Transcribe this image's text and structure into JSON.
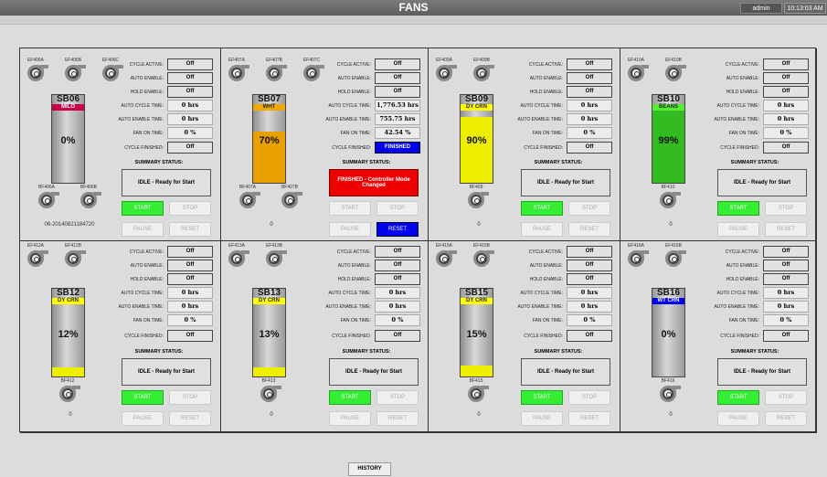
{
  "header": {
    "title": "FANS",
    "user": "admin",
    "time": "10:13:03 AM"
  },
  "labels": {
    "cycle_active": "CYCLE ACTIVE:",
    "auto_enable": "AUTO ENABLE:",
    "hold_enable": "HOLD ENABLE:",
    "auto_cycle_time": "AUTO CYCLE TIME:",
    "auto_enable_time": "AUTO ENABLE TIME:",
    "fan_on_time": "FAN ON TIME:",
    "cycle_finished": "CYCLE FINISHED:",
    "summary_status": "SUMMARY STATUS:",
    "start": "START",
    "stop": "STOP",
    "pause": "PAUSE",
    "reset": "RESET"
  },
  "colors": {
    "milo": "#c8004a",
    "wht": "#f0a800",
    "dycrn": "#ffff00",
    "beans": "#33cc22",
    "wtcrn": "#0000ee",
    "start_green": "#33ee33",
    "reset_blue": "#0000ee",
    "finished_red": "#ee0000"
  },
  "panels": [
    {
      "name": "SB06",
      "crop": "MILO",
      "crop_color": "#c8004a",
      "crop_text": "#ffffff",
      "level": 0,
      "fill_color": "#c8c8c8",
      "fans_top": [
        "EF406A",
        "EF406B",
        "EF406C"
      ],
      "fans_bottom": [
        "BF406A",
        "BF406B"
      ],
      "cycle_active": "Off",
      "auto_enable": "Off",
      "hold_enable": "Off",
      "auto_cycle_time": "0 hrs",
      "auto_enable_time": "0 hrs",
      "fan_on_time": "0 %",
      "cycle_finished": "Off",
      "summary": "IDLE - Ready for Start",
      "summary_state": "idle",
      "counter": "06-20140821184720",
      "buttons": {
        "start": "enabled",
        "stop": "disabled",
        "pause": "disabled",
        "reset": "disabled"
      }
    },
    {
      "name": "SB07",
      "crop": "WHT",
      "crop_color": "#f0a800",
      "crop_text": "#222222",
      "level": 70,
      "fill_color": "#e8a000",
      "fans_top": [
        "EF407A",
        "EF407B",
        "EF407C"
      ],
      "fans_bottom": [
        "BF407A",
        "BF407B"
      ],
      "cycle_active": "Off",
      "auto_enable": "Off",
      "hold_enable": "Off",
      "auto_cycle_time": "1,776.53 hrs",
      "auto_enable_time": "755.75 hrs",
      "fan_on_time": "42.54 %",
      "cycle_finished": "FINISHED",
      "summary": "FINISHED - Controller Mode Changed",
      "summary_state": "finished",
      "counter": "0",
      "buttons": {
        "start": "disabled",
        "stop": "disabled",
        "pause": "disabled",
        "reset": "active"
      }
    },
    {
      "name": "SB09",
      "crop": "DY CRN",
      "crop_color": "#ffff00",
      "crop_text": "#222222",
      "level": 90,
      "fill_color": "#eeee00",
      "fans_top": [
        "EF409A",
        "EF409B"
      ],
      "fans_bottom": [
        "BF409"
      ],
      "cycle_active": "Off",
      "auto_enable": "Off",
      "hold_enable": "Off",
      "auto_cycle_time": "0 hrs",
      "auto_enable_time": "0 hrs",
      "fan_on_time": "0 %",
      "cycle_finished": "Off",
      "summary": "IDLE - Ready for Start",
      "summary_state": "idle",
      "counter": "0",
      "buttons": {
        "start": "enabled",
        "stop": "disabled",
        "pause": "disabled",
        "reset": "disabled"
      }
    },
    {
      "name": "SB10",
      "crop": "BEANS",
      "crop_color": "#55ee33",
      "crop_text": "#222222",
      "level": 99,
      "fill_color": "#33bb22",
      "fans_top": [
        "EF410A",
        "EF410B"
      ],
      "fans_bottom": [
        "BF410"
      ],
      "cycle_active": "Off",
      "auto_enable": "Off",
      "hold_enable": "Off",
      "auto_cycle_time": "0 hrs",
      "auto_enable_time": "0 hrs",
      "fan_on_time": "0 %",
      "cycle_finished": "Off",
      "summary": "IDLE - Ready for Start",
      "summary_state": "idle",
      "counter": "0",
      "buttons": {
        "start": "enabled",
        "stop": "disabled",
        "pause": "disabled",
        "reset": "disabled"
      }
    },
    {
      "name": "SB12",
      "crop": "DY CRN",
      "crop_color": "#ffff00",
      "crop_text": "#222222",
      "level": 12,
      "fill_color": "#eeee00",
      "fans_top": [
        "EF412A",
        "EF412B"
      ],
      "fans_bottom": [
        "BF412"
      ],
      "cycle_active": "Off",
      "auto_enable": "Off",
      "hold_enable": "Off",
      "auto_cycle_time": "0 hrs",
      "auto_enable_time": "0 hrs",
      "fan_on_time": "0 %",
      "cycle_finished": "Off",
      "summary": "IDLE - Ready for Start",
      "summary_state": "idle",
      "counter": "0",
      "buttons": {
        "start": "enabled",
        "stop": "disabled",
        "pause": "disabled",
        "reset": "disabled"
      }
    },
    {
      "name": "SB13",
      "crop": "DY CRN",
      "crop_color": "#ffff00",
      "crop_text": "#222222",
      "level": 13,
      "fill_color": "#eeee00",
      "fans_top": [
        "EF413A",
        "EF413B"
      ],
      "fans_bottom": [
        "BF413"
      ],
      "cycle_active": "Off",
      "auto_enable": "Off",
      "hold_enable": "Off",
      "auto_cycle_time": "0 hrs",
      "auto_enable_time": "0 hrs",
      "fan_on_time": "0 %",
      "cycle_finished": "Off",
      "summary": "IDLE - Ready for Start",
      "summary_state": "idle",
      "counter": "0",
      "buttons": {
        "start": "enabled",
        "stop": "disabled",
        "pause": "disabled",
        "reset": "disabled"
      }
    },
    {
      "name": "SB15",
      "crop": "DY CRN",
      "crop_color": "#ffff00",
      "crop_text": "#222222",
      "level": 15,
      "fill_color": "#eeee00",
      "fans_top": [
        "EF415A",
        "EF415B"
      ],
      "fans_bottom": [
        "BF415"
      ],
      "cycle_active": "Off",
      "auto_enable": "Off",
      "hold_enable": "Off",
      "auto_cycle_time": "0 hrs",
      "auto_enable_time": "0 hrs",
      "fan_on_time": "0 %",
      "cycle_finished": "Off",
      "summary": "IDLE - Ready for Start",
      "summary_state": "idle",
      "counter": "0",
      "buttons": {
        "start": "enabled",
        "stop": "disabled",
        "pause": "disabled",
        "reset": "disabled"
      }
    },
    {
      "name": "SB16",
      "crop": "WT CRN",
      "crop_color": "#0000ee",
      "crop_text": "#ffffff",
      "level": 0,
      "fill_color": "#c8c8c8",
      "fans_top": [
        "EF416A",
        "EF416B"
      ],
      "fans_bottom": [
        "BF416"
      ],
      "cycle_active": "Off",
      "auto_enable": "Off",
      "hold_enable": "Off",
      "auto_cycle_time": "0 hrs",
      "auto_enable_time": "0 hrs",
      "fan_on_time": "0 %",
      "cycle_finished": "Off",
      "summary": "IDLE - Ready for Start",
      "summary_state": "idle",
      "counter": "0",
      "buttons": {
        "start": "enabled",
        "stop": "disabled",
        "pause": "disabled",
        "reset": "disabled"
      }
    }
  ],
  "footer": {
    "history": "HISTORY"
  }
}
